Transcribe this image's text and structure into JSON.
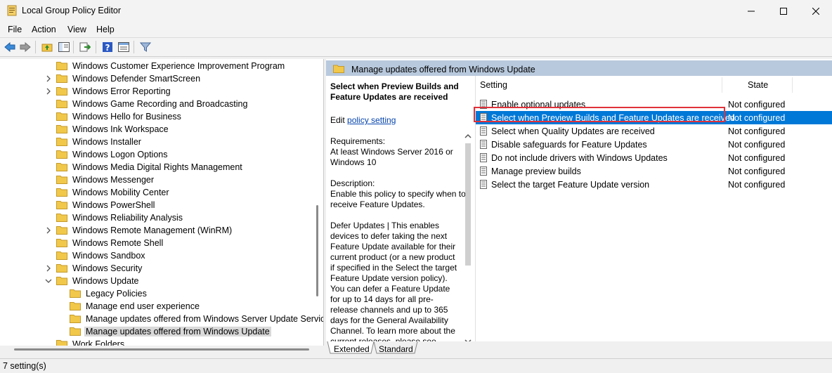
{
  "window": {
    "title": "Local Group Policy Editor"
  },
  "menu": [
    "File",
    "Action",
    "View",
    "Help"
  ],
  "tree": {
    "items": [
      {
        "label": "Windows Customer Experience Improvement Program",
        "expandable": false,
        "indent": 0,
        "selected": false
      },
      {
        "label": "Windows Defender SmartScreen",
        "expandable": true,
        "indent": 0,
        "selected": false
      },
      {
        "label": "Windows Error Reporting",
        "expandable": true,
        "indent": 0,
        "selected": false
      },
      {
        "label": "Windows Game Recording and Broadcasting",
        "expandable": false,
        "indent": 0,
        "selected": false
      },
      {
        "label": "Windows Hello for Business",
        "expandable": false,
        "indent": 0,
        "selected": false
      },
      {
        "label": "Windows Ink Workspace",
        "expandable": false,
        "indent": 0,
        "selected": false
      },
      {
        "label": "Windows Installer",
        "expandable": false,
        "indent": 0,
        "selected": false
      },
      {
        "label": "Windows Logon Options",
        "expandable": false,
        "indent": 0,
        "selected": false
      },
      {
        "label": "Windows Media Digital Rights Management",
        "expandable": false,
        "indent": 0,
        "selected": false
      },
      {
        "label": "Windows Messenger",
        "expandable": false,
        "indent": 0,
        "selected": false
      },
      {
        "label": "Windows Mobility Center",
        "expandable": false,
        "indent": 0,
        "selected": false
      },
      {
        "label": "Windows PowerShell",
        "expandable": false,
        "indent": 0,
        "selected": false
      },
      {
        "label": "Windows Reliability Analysis",
        "expandable": false,
        "indent": 0,
        "selected": false
      },
      {
        "label": "Windows Remote Management (WinRM)",
        "expandable": true,
        "indent": 0,
        "selected": false
      },
      {
        "label": "Windows Remote Shell",
        "expandable": false,
        "indent": 0,
        "selected": false
      },
      {
        "label": "Windows Sandbox",
        "expandable": false,
        "indent": 0,
        "selected": false
      },
      {
        "label": "Windows Security",
        "expandable": true,
        "indent": 0,
        "selected": false
      },
      {
        "label": "Windows Update",
        "expandable": true,
        "expanded": true,
        "indent": 0,
        "selected": false
      },
      {
        "label": "Legacy Policies",
        "expandable": false,
        "indent": 1,
        "selected": false
      },
      {
        "label": "Manage end user experience",
        "expandable": false,
        "indent": 1,
        "selected": false
      },
      {
        "label": "Manage updates offered from Windows Server Update Servic",
        "expandable": false,
        "indent": 1,
        "selected": false
      },
      {
        "label": "Manage updates offered from Windows Update",
        "expandable": false,
        "indent": 1,
        "selected": true
      },
      {
        "label": "Work Folders",
        "expandable": false,
        "indent": 0,
        "selected": false
      }
    ]
  },
  "right": {
    "header": "Manage updates offered from Windows Update",
    "description": {
      "title": "Select when Preview Builds and Feature Updates are received",
      "edit_prefix": "Edit",
      "edit_link": "policy setting",
      "requirements_label": "Requirements:",
      "requirements": "At least Windows Server 2016 or Windows 10",
      "description_label": "Description:",
      "description": "Enable this policy to specify when to receive Feature Updates.",
      "defer": "Defer Updates | This enables devices to defer taking the next Feature Update available for their current product (or a new product if specified in the Select the target Feature Update version policy). You can defer a Feature Update for up to 14 days for all pre-release channels and up to 365 days for the General Availability Channel. To learn more about the current releases, please see"
    },
    "columns": {
      "setting": "Setting",
      "state": "State"
    },
    "settings": [
      {
        "setting": "Enable optional updates",
        "state": "Not configured",
        "selected": false
      },
      {
        "setting": "Select when Preview Builds and Feature Updates are received",
        "state": "Not configured",
        "selected": true
      },
      {
        "setting": "Select when Quality Updates are received",
        "state": "Not configured",
        "selected": false
      },
      {
        "setting": "Disable safeguards for Feature Updates",
        "state": "Not configured",
        "selected": false
      },
      {
        "setting": "Do not include drivers with Windows Updates",
        "state": "Not configured",
        "selected": false
      },
      {
        "setting": "Manage preview builds",
        "state": "Not configured",
        "selected": false
      },
      {
        "setting": "Select the target Feature Update version",
        "state": "Not configured",
        "selected": false
      }
    ],
    "tabs": [
      "Extended",
      "Standard"
    ]
  },
  "status": "7 setting(s)",
  "colors": {
    "selection": "#0078d7",
    "header_strip": "#b8c9dd",
    "highlight_box": "#e0313a",
    "folder": "#f2c84b"
  }
}
